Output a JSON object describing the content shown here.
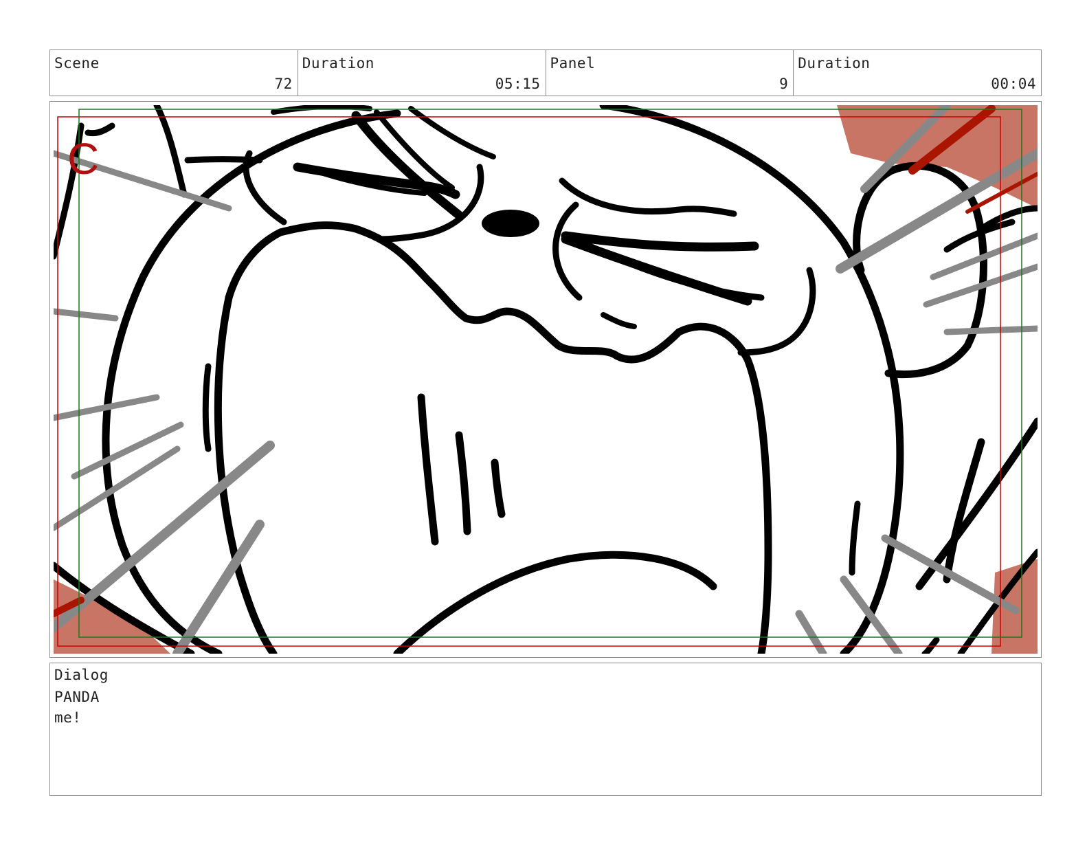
{
  "header": {
    "scene": {
      "label": "Scene",
      "value": "72"
    },
    "scene_duration": {
      "label": "Duration",
      "value": "05:15"
    },
    "panel": {
      "label": "Panel",
      "value": "9"
    },
    "panel_duration": {
      "label": "Duration",
      "value": "00:04"
    }
  },
  "drawing": {
    "camera_marker": "C",
    "colors": {
      "ink": "#000000",
      "motion_lines": "#888888",
      "red_guide": "#cc0000",
      "green_guide": "#1a7a1a",
      "blush": "#c97565",
      "dark_red_stroke": "#aa1500"
    }
  },
  "dialog": {
    "label": "Dialog",
    "character": "PANDA",
    "line": "me!"
  }
}
